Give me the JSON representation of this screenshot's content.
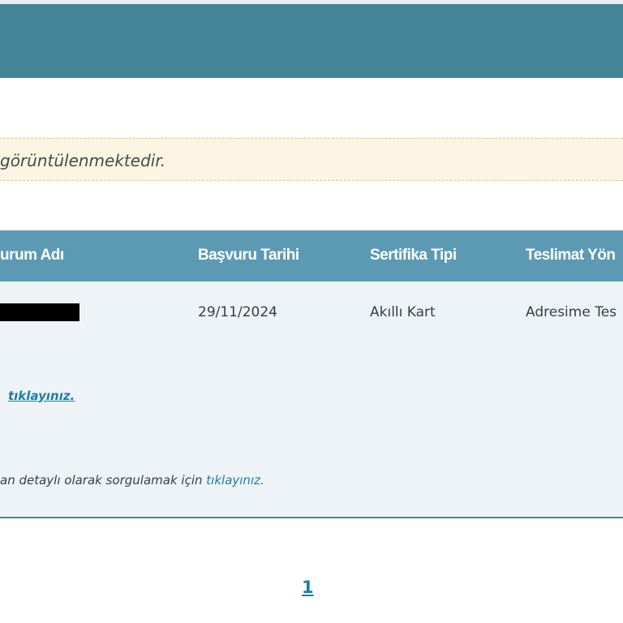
{
  "notice": {
    "text": "görüntülenmektedir."
  },
  "table": {
    "columns": [
      "urum Adı",
      "Başvuru Tarihi",
      "Sertifika Tipi",
      "Teslimat Yön"
    ],
    "rows": [
      {
        "institution": "",
        "application_date": "29/11/2024",
        "certificate_type": "Akıllı Kart",
        "delivery_method": "Adresime Tes"
      }
    ],
    "link_text": "tıklayınız.",
    "detail_prefix": "an detaylı olarak sorgulamak için ",
    "detail_link": "tıklayınız."
  },
  "pagination": {
    "current_page": "1"
  },
  "colors": {
    "header": "#448497",
    "table_header": "#5c9ab4",
    "table_body": "#eef3f8",
    "link": "#1f7ea1",
    "notice_bg": "#fdf5e4",
    "notice_border": "#f0c060"
  }
}
